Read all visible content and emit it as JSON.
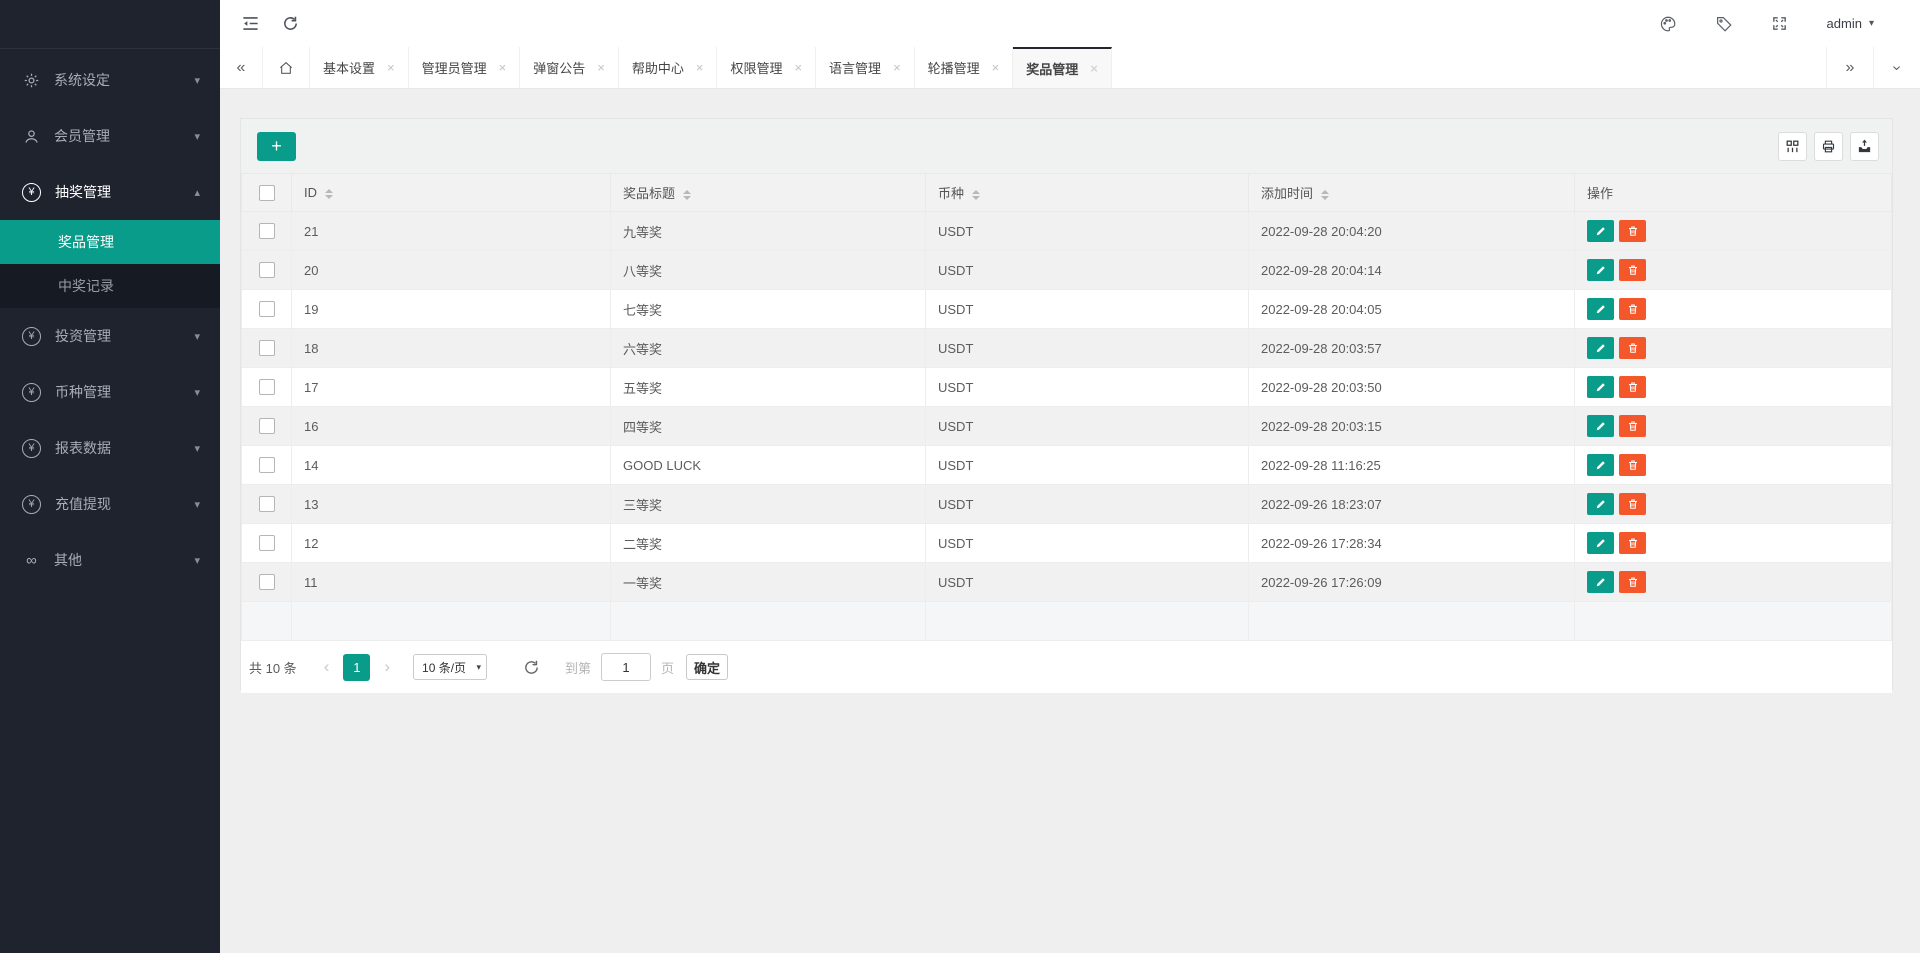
{
  "colors": {
    "accent": "#0a9c8a",
    "danger": "#f4582a",
    "sidebar_bg": "#1f232e",
    "active_tab_border": "#23262d"
  },
  "icons": {
    "yen-icon": "¥",
    "infinity-icon": "∞",
    "close-icon": "×",
    "chevron-down-icon": "▾",
    "chevron-up-icon": "▴",
    "caret-down-icon": "▾",
    "prev-icon": "‹",
    "next-icon": "›",
    "collapse-tabs-icon": "«",
    "expand-tabs-icon": "»"
  },
  "sidebar": {
    "items": [
      {
        "label": "系统设定",
        "icon": "gear-icon",
        "expanded": false
      },
      {
        "label": "会员管理",
        "icon": "user-icon",
        "expanded": false
      },
      {
        "label": "抽奖管理",
        "icon": "yen-icon",
        "expanded": true,
        "children": [
          {
            "label": "奖品管理",
            "active": true
          },
          {
            "label": "中奖记录",
            "active": false
          }
        ]
      },
      {
        "label": "投资管理",
        "icon": "yen-icon",
        "expanded": false
      },
      {
        "label": "币种管理",
        "icon": "yen-icon",
        "expanded": false
      },
      {
        "label": "报表数据",
        "icon": "yen-icon",
        "expanded": false
      },
      {
        "label": "充值提现",
        "icon": "yen-icon",
        "expanded": false
      },
      {
        "label": "其他",
        "icon": "infinity-icon",
        "expanded": false
      }
    ]
  },
  "topbar": {
    "user": "admin"
  },
  "tabs": {
    "items": [
      "基本设置",
      "管理员管理",
      "弹窗公告",
      "帮助中心",
      "权限管理",
      "语言管理",
      "轮播管理",
      "奖品管理"
    ],
    "active_index": 7
  },
  "toolbar": {
    "add_label": "+"
  },
  "table": {
    "headers": [
      "ID",
      "奖品标题",
      "币种",
      "添加时间",
      "操作"
    ],
    "rows": [
      {
        "id": "21",
        "title": "九等奖",
        "currency": "USDT",
        "time": "2022-09-28 20:04:20"
      },
      {
        "id": "20",
        "title": "八等奖",
        "currency": "USDT",
        "time": "2022-09-28 20:04:14"
      },
      {
        "id": "19",
        "title": "七等奖",
        "currency": "USDT",
        "time": "2022-09-28 20:04:05"
      },
      {
        "id": "18",
        "title": "六等奖",
        "currency": "USDT",
        "time": "2022-09-28 20:03:57"
      },
      {
        "id": "17",
        "title": "五等奖",
        "currency": "USDT",
        "time": "2022-09-28 20:03:50"
      },
      {
        "id": "16",
        "title": "四等奖",
        "currency": "USDT",
        "time": "2022-09-28 20:03:15"
      },
      {
        "id": "14",
        "title": "GOOD LUCK",
        "currency": "USDT",
        "time": "2022-09-28 11:16:25"
      },
      {
        "id": "13",
        "title": "三等奖",
        "currency": "USDT",
        "time": "2022-09-26 18:23:07"
      },
      {
        "id": "12",
        "title": "二等奖",
        "currency": "USDT",
        "time": "2022-09-26 17:28:34"
      },
      {
        "id": "11",
        "title": "一等奖",
        "currency": "USDT",
        "time": "2022-09-26 17:26:09"
      }
    ]
  },
  "pagination": {
    "total_text": "共 10 条",
    "current_page": "1",
    "page_size": "10 条/页",
    "goto_prefix": "到第",
    "goto_value": "1",
    "goto_suffix": "页",
    "confirm_label": "确定"
  }
}
